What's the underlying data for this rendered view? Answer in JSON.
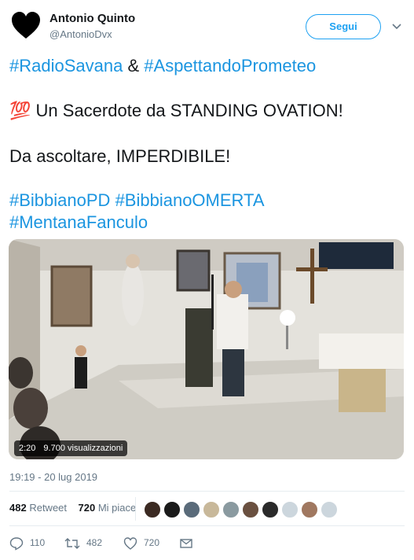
{
  "author": {
    "name": "Antonio Quinto",
    "handle": "@AntonioDvx",
    "avatar_icon": "black-heart-icon"
  },
  "follow_button": {
    "label": "Segui",
    "color": "#1da1f2"
  },
  "caret_icon": "chevron-down-icon",
  "tweet": {
    "line1": {
      "tag1": "#RadioSavana",
      "join": "&",
      "tag2": "#AspettandoPrometeo"
    },
    "line2": {
      "emoji": "💯",
      "text": "Un Sacerdote da STANDING OVATION!"
    },
    "line3": {
      "text": "Da ascoltare, IMPERDIBILE!"
    },
    "line4": {
      "tag1": "#BibbianoPD",
      "tag2": "#BibbianoOMERTA"
    },
    "line5": {
      "tag1": "#MentanaFanculo"
    },
    "hashtag_color": "#1b95e0"
  },
  "video": {
    "duration": "2:20",
    "views": "9.700 visualizzazioni"
  },
  "timestamp": "19:19 - 20 lug 2019",
  "stats": {
    "retweets_count": "482",
    "retweets_label": "Retweet",
    "likes_count": "720",
    "likes_label": "Mi piace"
  },
  "likers": [
    {
      "name": "liker-avatar"
    },
    {
      "name": "liker-avatar"
    },
    {
      "name": "liker-avatar"
    },
    {
      "name": "liker-avatar"
    },
    {
      "name": "liker-avatar"
    },
    {
      "name": "liker-avatar"
    },
    {
      "name": "liker-avatar"
    },
    {
      "name": "liker-avatar"
    },
    {
      "name": "liker-avatar"
    },
    {
      "name": "liker-avatar"
    }
  ],
  "actions": {
    "reply_count": "110",
    "retweet_count": "482",
    "like_count": "720",
    "reply_icon": "reply-icon",
    "retweet_icon": "retweet-icon",
    "like_icon": "heart-outline-icon",
    "message_icon": "envelope-icon"
  }
}
